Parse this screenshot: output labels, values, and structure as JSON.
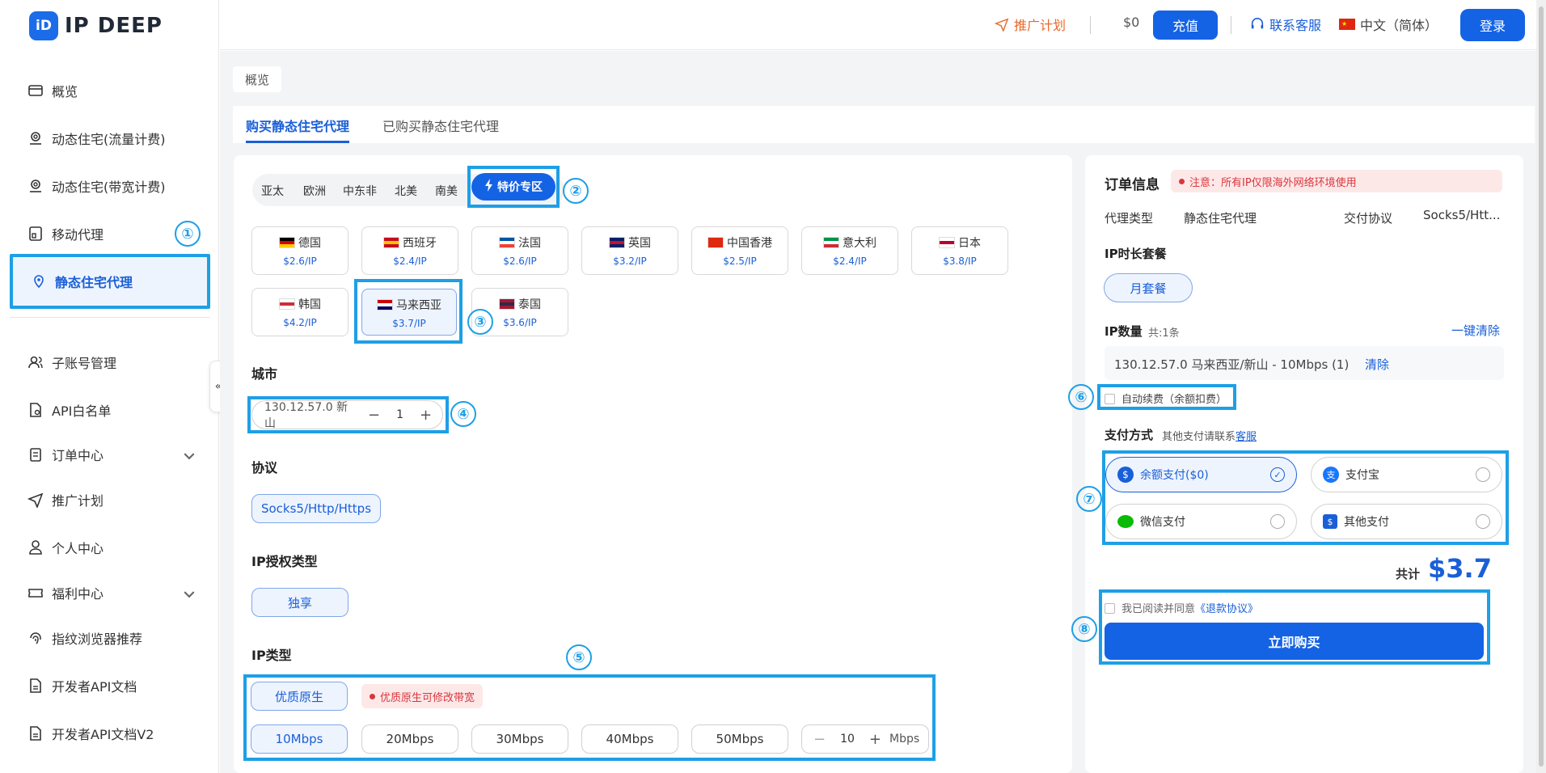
{
  "brand": {
    "name": "IP DEEP",
    "mark": "iD"
  },
  "header": {
    "promo": "推广计划",
    "balance": "$0",
    "recharge": "充值",
    "support": "联系客服",
    "language": "中文（简体）",
    "login": "登录"
  },
  "sidebar": {
    "items": [
      {
        "label": "概览",
        "icon": "overview-icon"
      },
      {
        "label": "动态住宅(流量计费)",
        "icon": "location-icon"
      },
      {
        "label": "动态住宅(带宽计费)",
        "icon": "location-icon"
      },
      {
        "label": "移动代理",
        "icon": "mobile-icon"
      },
      {
        "label": "静态住宅代理",
        "icon": "pin-icon"
      },
      {
        "label": "子账号管理",
        "icon": "users-icon"
      },
      {
        "label": "API白名单",
        "icon": "api-icon"
      },
      {
        "label": "订单中心",
        "icon": "clipboard-icon"
      },
      {
        "label": "推广计划",
        "icon": "send-icon"
      },
      {
        "label": "个人中心",
        "icon": "user-icon"
      },
      {
        "label": "福利中心",
        "icon": "ticket-icon"
      },
      {
        "label": "指纹浏览器推荐",
        "icon": "fingerprint-icon"
      },
      {
        "label": "开发者API文档",
        "icon": "doc-icon"
      },
      {
        "label": "开发者API文档V2",
        "icon": "doc-icon"
      }
    ]
  },
  "breadcrumb": "概览",
  "tabs": [
    "购买静态住宅代理",
    "已购买静态住宅代理"
  ],
  "regions": [
    "亚太",
    "欧洲",
    "中东非",
    "北美",
    "南美"
  ],
  "special": "特价专区",
  "countries": [
    {
      "name": "德国",
      "price": "$2.6/IP",
      "colors": [
        "#000000",
        "#dd0000",
        "#ffce00"
      ]
    },
    {
      "name": "西班牙",
      "price": "$2.4/IP",
      "colors": [
        "#c60b1e",
        "#ffc400",
        "#c60b1e"
      ]
    },
    {
      "name": "法国",
      "price": "$2.6/IP",
      "colors": [
        "#0055a4",
        "#ffffff",
        "#ef4135"
      ]
    },
    {
      "name": "英国",
      "price": "$3.2/IP",
      "colors": [
        "#012169",
        "#c8102e",
        "#012169"
      ]
    },
    {
      "name": "中国香港",
      "price": "$2.5/IP",
      "colors": [
        "#de2910",
        "#de2910",
        "#de2910"
      ]
    },
    {
      "name": "意大利",
      "price": "$2.4/IP",
      "colors": [
        "#009246",
        "#ffffff",
        "#ce2b37"
      ]
    },
    {
      "name": "日本",
      "price": "$3.8/IP",
      "colors": [
        "#ffffff",
        "#bc002d",
        "#ffffff"
      ]
    },
    {
      "name": "韩国",
      "price": "$4.2/IP",
      "colors": [
        "#ffffff",
        "#cd2e3a",
        "#ffffff"
      ]
    },
    {
      "name": "马来西亚",
      "price": "$3.7/IP",
      "colors": [
        "#cc0001",
        "#ffffff",
        "#010066"
      ]
    },
    {
      "name": "泰国",
      "price": "$3.6/IP",
      "colors": [
        "#a51931",
        "#2d2a4a",
        "#a51931"
      ]
    }
  ],
  "city": {
    "title": "城市",
    "value": "130.12.57.0 新山",
    "qty": "1"
  },
  "protocol": {
    "title": "协议",
    "value": "Socks5/Http/Https"
  },
  "auth": {
    "title": "IP授权类型",
    "value": "独享"
  },
  "iptype": {
    "title": "IP类型",
    "value": "优质原生",
    "note": "优质原生可修改带宽",
    "bandwidths": [
      "10Mbps",
      "20Mbps",
      "30Mbps",
      "40Mbps",
      "50Mbps"
    ],
    "custom": "10",
    "unit": "Mbps"
  },
  "order": {
    "title": "订单信息",
    "notice": "注意：所有IP仅限海外网络环境使用",
    "proxy_type_label": "代理类型",
    "proxy_type": "静态住宅代理",
    "protocol_label": "交付协议",
    "protocol": "Socks5/Htt...",
    "package_title": "IP时长套餐",
    "package": "月套餐",
    "count_title": "IP数量",
    "count_sub": "共:1条",
    "clear_all": "一键清除",
    "item": "130.12.57.0 马来西亚/新山 - 10Mbps (1)",
    "clear": "清除",
    "auto_renew": "自动续费（余额扣费）",
    "pay_title": "支付方式",
    "pay_sub": "其他支付请联系",
    "pay_link": "客服",
    "pay": [
      "余额支付($0)",
      "支付宝",
      "微信支付",
      "其他支付"
    ],
    "total_label": "共计",
    "total": "$3.7",
    "agree": "我已阅读并同意",
    "agree_link": "《退款协议》",
    "buy": "立即购买"
  },
  "markers": [
    "①",
    "②",
    "③",
    "④",
    "⑤",
    "⑥",
    "⑦",
    "⑧"
  ],
  "colors": {
    "primary": "#1563e5",
    "highlight": "#1e9fe6",
    "warn": "#d9363e"
  }
}
